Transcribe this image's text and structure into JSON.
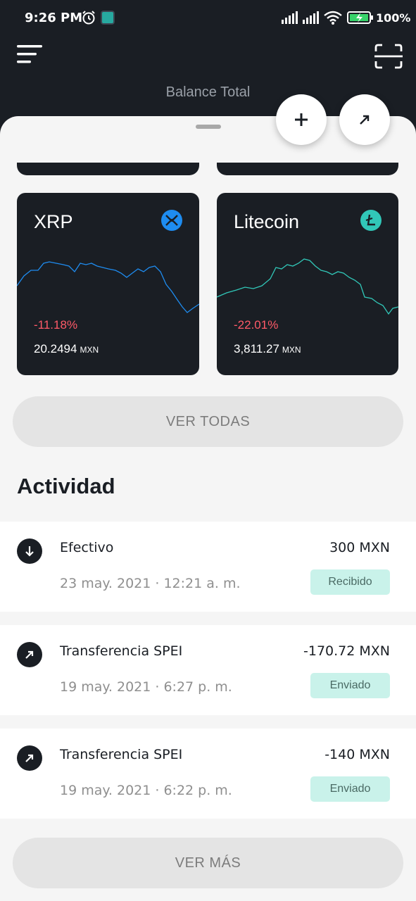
{
  "status_bar": {
    "time": "9:26 PM",
    "battery_percent": "100%"
  },
  "header": {
    "balance_label": "Balance Total",
    "menu_icon": "menu-icon",
    "scan_icon": "scan-icon"
  },
  "actions": {
    "add_icon": "plus-icon",
    "send_icon": "arrow-up-right-icon"
  },
  "coins": [
    {
      "name": "XRP",
      "change": "-11.18%",
      "value": "20.2494",
      "unit": "MXN",
      "logo_color": "#1e8cf0"
    },
    {
      "name": "Litecoin",
      "change": "-22.01%",
      "value": "3,811.27",
      "unit": "MXN",
      "logo_color": "#31c7b8"
    }
  ],
  "ver_todas_label": "VER TODAS",
  "activity": {
    "title": "Actividad",
    "items": [
      {
        "title": "Efectivo",
        "date": "23 may. 2021 · 12:21 a. m.",
        "amount": "300 MXN",
        "status": "Recibido",
        "icon": "arrow-down-icon"
      },
      {
        "title": "Transferencia SPEI",
        "date": "19 may. 2021 · 6:27 p. m.",
        "amount": "-170.72 MXN",
        "status": "Enviado",
        "icon": "arrow-up-right-icon"
      },
      {
        "title": "Transferencia SPEI",
        "date": "19 may. 2021 · 6:22 p. m.",
        "amount": "-140 MXN",
        "status": "Enviado",
        "icon": "arrow-up-right-icon"
      }
    ]
  },
  "ver_mas_label": "VER MÁS",
  "colors": {
    "dark": "#1a1e24",
    "negative": "#ff5a68",
    "status_bg": "#c9f2ea",
    "xrp_line": "#1e8cf0",
    "ltc_line": "#31c7b8"
  }
}
